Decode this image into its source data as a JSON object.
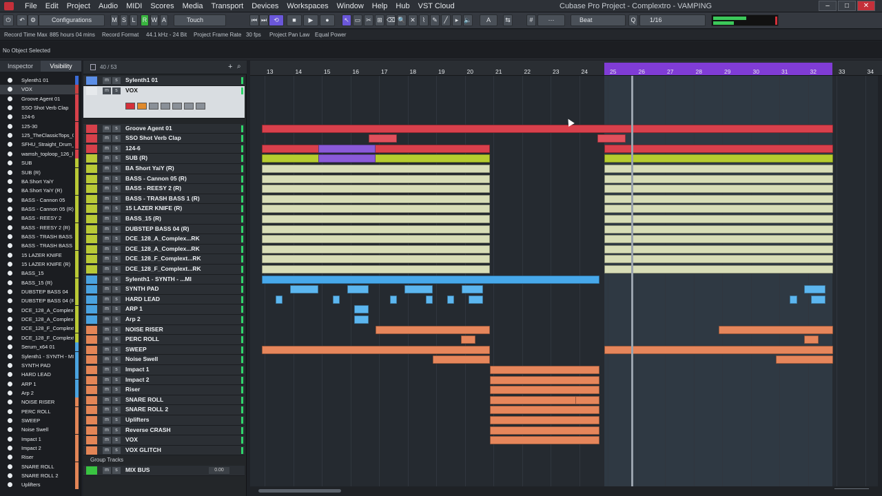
{
  "menubar": {
    "items": [
      "File",
      "Edit",
      "Project",
      "Audio",
      "MIDI",
      "Scores",
      "Media",
      "Transport",
      "Devices",
      "Workspaces",
      "Window",
      "Help",
      "Hub",
      "VST Cloud"
    ],
    "window_title": "Cubase Pro Project - Complextro - VAMPING"
  },
  "toolbar": {
    "configurations": "Configurations",
    "m": "M",
    "s": "S",
    "l": "L",
    "r": "R",
    "w": "W",
    "a": "A",
    "automation_mode": "Touch",
    "snap_type": "Beat",
    "quantize": "1/16"
  },
  "infobar": {
    "record_time_max_label": "Record Time Max",
    "record_time_max_value": "885 hours 04 mins",
    "record_format_label": "Record Format",
    "record_format_value": "44.1 kHz - 24 Bit",
    "frame_rate_label": "Project Frame Rate",
    "frame_rate_value": "30 fps",
    "pan_law_label": "Project Pan Law",
    "pan_law_value": "Equal Power"
  },
  "status": "No Object Selected",
  "left_panel": {
    "tabs": [
      "Inspector",
      "Visibility"
    ],
    "active_tab": "Visibility",
    "tracks": [
      {
        "name": "Sylenth1 01",
        "color": "#3a6bd6"
      },
      {
        "name": "VOX",
        "color": "#c94040"
      },
      {
        "name": "Groove Agent 01",
        "color": "#d6404a"
      },
      {
        "name": "SSO Shot Verb Clap",
        "color": "#d6404a"
      },
      {
        "name": "124-6",
        "color": "#d6404a"
      },
      {
        "name": "125-30",
        "color": "#d6404a"
      },
      {
        "name": "125_TheClassicTops_0",
        "color": "#d6404a"
      },
      {
        "name": "SFHU_Straight_Drum_",
        "color": "#d6404a"
      },
      {
        "name": "wamsh_toploop_126_l",
        "color": "#d6404a"
      },
      {
        "name": "SUB",
        "color": "#b9c936"
      },
      {
        "name": "SUB (R)",
        "color": "#b9c936"
      },
      {
        "name": "BA Short YaiY",
        "color": "#b9c936"
      },
      {
        "name": "BA Short YaiY (R)",
        "color": "#b9c936"
      },
      {
        "name": "BASS - Cannon 05",
        "color": "#b9c936"
      },
      {
        "name": "BASS - Cannon 05 (R)",
        "color": "#b9c936"
      },
      {
        "name": "BASS - REESY 2",
        "color": "#b9c936"
      },
      {
        "name": "BASS - REESY 2 (R)",
        "color": "#b9c936"
      },
      {
        "name": "BASS - TRASH BASS 1",
        "color": "#b9c936"
      },
      {
        "name": "BASS - TRASH BASS 1",
        "color": "#b9c936"
      },
      {
        "name": "15 LAZER KNIFE",
        "color": "#b9c936"
      },
      {
        "name": "15 LAZER KNIFE (R)",
        "color": "#b9c936"
      },
      {
        "name": "BASS_15",
        "color": "#b9c936"
      },
      {
        "name": "BASS_15 (R)",
        "color": "#b9c936"
      },
      {
        "name": "DUBSTEP BASS 04",
        "color": "#b9c936"
      },
      {
        "name": "DUBSTEP BASS 04 (R)",
        "color": "#b9c936"
      },
      {
        "name": "DCE_128_A_Complextr",
        "color": "#b9c936"
      },
      {
        "name": "DCE_128_A_Complextr",
        "color": "#b9c936"
      },
      {
        "name": "DCE_128_F_Complextr",
        "color": "#b9c936"
      },
      {
        "name": "DCE_128_F_Complextr",
        "color": "#b9c936"
      },
      {
        "name": "Serum_x64 01",
        "color": "#4aa3e0"
      },
      {
        "name": "Sylenth1 - SYNTH - MI",
        "color": "#4aa3e0"
      },
      {
        "name": "SYNTH PAD",
        "color": "#4aa3e0"
      },
      {
        "name": "HARD LEAD",
        "color": "#4aa3e0"
      },
      {
        "name": "ARP 1",
        "color": "#4aa3e0"
      },
      {
        "name": "Arp 2",
        "color": "#4aa3e0"
      },
      {
        "name": "NOISE RISER",
        "color": "#e38556"
      },
      {
        "name": "PERC ROLL",
        "color": "#e38556"
      },
      {
        "name": "SWEEP",
        "color": "#e38556"
      },
      {
        "name": "Noise Swell",
        "color": "#e38556"
      },
      {
        "name": "Impact 1",
        "color": "#e38556"
      },
      {
        "name": "Impact 2",
        "color": "#e38556"
      },
      {
        "name": "Riser",
        "color": "#e38556"
      },
      {
        "name": "SNARE ROLL",
        "color": "#e38556"
      },
      {
        "name": "SNARE ROLL 2",
        "color": "#e38556"
      },
      {
        "name": "Uplifters",
        "color": "#e38556"
      }
    ]
  },
  "track_list": {
    "count": "40 / 53",
    "tracks": [
      {
        "name": "Sylenth1 01",
        "color": "#5b8ee6",
        "num": "1"
      },
      {
        "name": "VOX",
        "color": "#e6e9ec",
        "num": "2"
      },
      {
        "name": "Groove Agent 01",
        "color": "#d6404a",
        "num": "3"
      },
      {
        "name": "SSO Shot Verb Clap",
        "color": "#d6404a",
        "num": "4"
      },
      {
        "name": "124-6",
        "color": "#d6404a",
        "num": "5"
      },
      {
        "name": "SUB (R)",
        "color": "#b9c936",
        "num": "10"
      },
      {
        "name": "BA Short YaiY (R)",
        "color": "#b9c936",
        "num": "12"
      },
      {
        "name": "BASS - Cannon 05 (R)",
        "color": "#b9c936",
        "num": "13"
      },
      {
        "name": "BASS - REESY 2 (R)",
        "color": "#b9c936",
        "num": "14"
      },
      {
        "name": "BASS - TRASH BASS 1 (R)",
        "color": "#b9c936",
        "num": "15"
      },
      {
        "name": "15 LAZER KNIFE (R)",
        "color": "#b9c936",
        "num": "16"
      },
      {
        "name": "BASS_15 (R)",
        "color": "#b9c936",
        "num": "17"
      },
      {
        "name": "DUBSTEP BASS 04 (R)",
        "color": "#b9c936",
        "num": "18"
      },
      {
        "name": "DCE_128_A_Complex...RK",
        "color": "#b9c936",
        "num": "19"
      },
      {
        "name": "DCE_128_A_Complex...RK",
        "color": "#b9c936",
        "num": "20"
      },
      {
        "name": "DCE_128_F_Complext...RK",
        "color": "#b9c936",
        "num": "21"
      },
      {
        "name": "DCE_128_F_Complext...RK",
        "color": "#b9c936",
        "num": "22"
      },
      {
        "name": "Sylenth1 - SYNTH - ...MI",
        "color": "#4aa3e0",
        "num": "23"
      },
      {
        "name": "SYNTH PAD",
        "color": "#4aa3e0",
        "num": "24"
      },
      {
        "name": "HARD LEAD",
        "color": "#4aa3e0",
        "num": "25"
      },
      {
        "name": "ARP 1",
        "color": "#4aa3e0",
        "num": "26"
      },
      {
        "name": "Arp 2",
        "color": "#4aa3e0",
        "num": "27"
      },
      {
        "name": "NOISE RISER",
        "color": "#e38556",
        "num": "28"
      },
      {
        "name": "PERC ROLL",
        "color": "#e38556",
        "num": "29"
      },
      {
        "name": "SWEEP",
        "color": "#e38556",
        "num": "30"
      },
      {
        "name": "Noise Swell",
        "color": "#e38556",
        "num": "31"
      },
      {
        "name": "Impact 1",
        "color": "#e38556",
        "num": "32"
      },
      {
        "name": "Impact 2",
        "color": "#e38556",
        "num": "33"
      },
      {
        "name": "Riser",
        "color": "#e38556",
        "num": "34"
      },
      {
        "name": "SNARE ROLL",
        "color": "#e38556",
        "num": "35"
      },
      {
        "name": "SNARE ROLL 2",
        "color": "#e38556",
        "num": "36"
      },
      {
        "name": "Uplifters",
        "color": "#e38556",
        "num": "37"
      },
      {
        "name": "Reverse CRASH",
        "color": "#e38556",
        "num": "38"
      },
      {
        "name": "VOX",
        "color": "#e38556",
        "num": "39"
      },
      {
        "name": "VOX GLITCH",
        "color": "#e38556",
        "num": "40"
      }
    ],
    "group_label": "Group Tracks",
    "mix_bus": {
      "name": "MIX BUS",
      "volume": "0.00"
    }
  },
  "ruler": {
    "bars": [
      "13",
      "14",
      "15",
      "16",
      "17",
      "18",
      "19",
      "20",
      "21",
      "22",
      "23",
      "24",
      "25",
      "26",
      "27",
      "28",
      "29",
      "30",
      "31",
      "32",
      "33",
      "34"
    ]
  }
}
